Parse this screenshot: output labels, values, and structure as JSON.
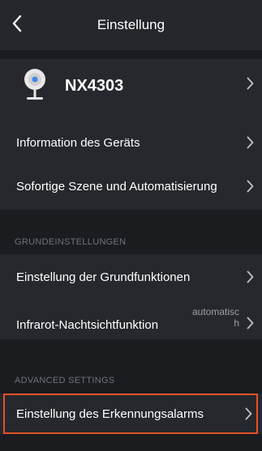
{
  "header": {
    "back_icon": "chevron-left-icon",
    "title": "Einstellung"
  },
  "device": {
    "icon": "camera-icon",
    "name": "NX4303",
    "chevron_icon": "chevron-right-icon"
  },
  "group1": {
    "items": [
      {
        "label": "Information des Geräts"
      },
      {
        "label": "Sofortige Szene und Automatisierung"
      }
    ]
  },
  "basic": {
    "section_title": "GRUNDEINSTELLUNGEN",
    "items": [
      {
        "label": "Einstellung der Grundfunktionen"
      },
      {
        "label": "Infrarot-Nachtsichtfunktion",
        "value": "automatisch"
      }
    ]
  },
  "advanced": {
    "section_title": "ADVANCED SETTINGS",
    "items": [
      {
        "label": "Einstellung des Erkennungsalarms"
      }
    ]
  },
  "colors": {
    "background": "#1b1c20",
    "row_background": "#26282d",
    "highlight": "#e3522a"
  }
}
